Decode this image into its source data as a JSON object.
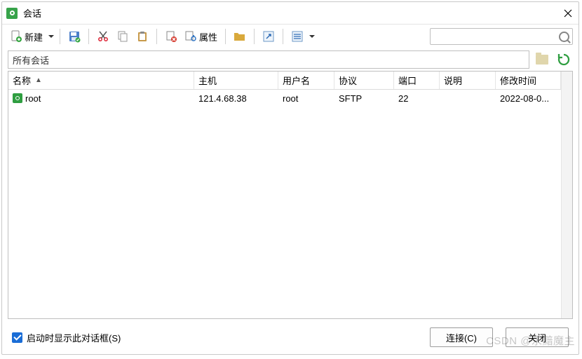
{
  "window": {
    "title": "会话"
  },
  "toolbar": {
    "new_label": "新建",
    "prop_label": "属性"
  },
  "search": {
    "placeholder": ""
  },
  "path": {
    "current": "所有会话"
  },
  "table": {
    "columns": [
      "名称",
      "主机",
      "用户名",
      "协议",
      "端口",
      "说明",
      "修改时间"
    ],
    "sortcol": 0,
    "rows": [
      {
        "name": "root",
        "host": "121.4.68.38",
        "user": "root",
        "proto": "SFTP",
        "port": "22",
        "desc": "",
        "mtime": "2022-08-0..."
      }
    ]
  },
  "footer": {
    "startup_checkbox": "启动时显示此对话框(S)",
    "connect": "连接(C)",
    "close": "关闭"
  },
  "watermark": "CSDN @永黯魔主"
}
